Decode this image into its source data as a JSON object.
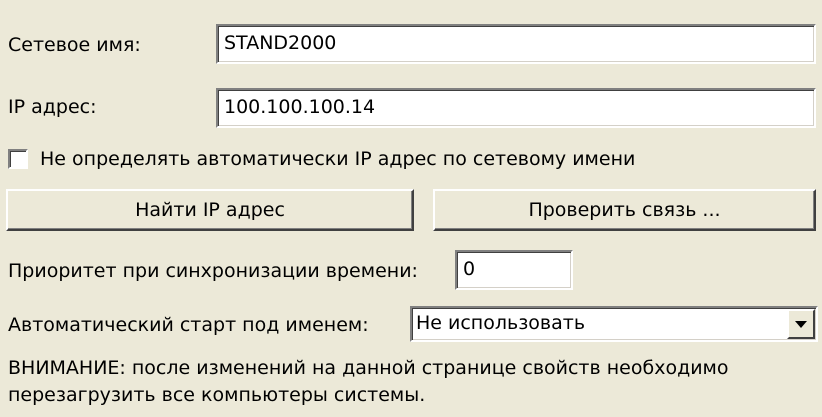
{
  "network_name": {
    "label": "Сетевое имя:",
    "value": "STAND2000"
  },
  "ip_address": {
    "label": "IP адрес:",
    "value": "100.100.100.14"
  },
  "auto_ip_checkbox": {
    "label": "Не определять автоматически IP адрес по сетевому имени",
    "checked": false
  },
  "buttons": {
    "find_ip": "Найти IP адрес",
    "check_connection": "Проверить связь ..."
  },
  "time_sync_priority": {
    "label": "Приоритет при синхронизации времени:",
    "value": "0"
  },
  "auto_start": {
    "label": "Автоматический старт под именем:",
    "selected": "Не использовать"
  },
  "warning": {
    "line1": "ВНИМАНИЕ: после изменений на данной странице свойств необходимо",
    "line2": "перезагрузить все компьютеры системы."
  },
  "colors": {
    "panel_background": "#ece9d8",
    "field_background": "#ffffff"
  }
}
